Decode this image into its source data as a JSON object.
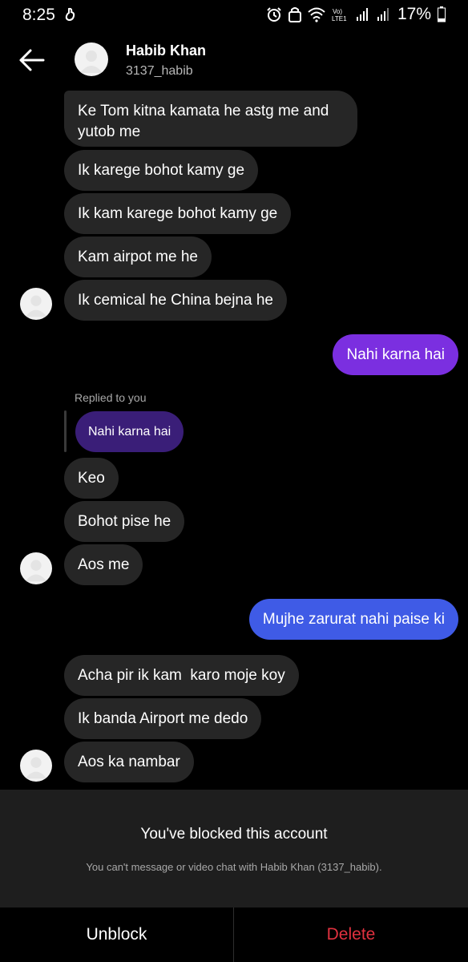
{
  "status_bar": {
    "time": "8:25",
    "battery": "17%",
    "network_label": "Vo) LTE1"
  },
  "header": {
    "name": "Habib Khan",
    "username": "3137_habib"
  },
  "messages": [
    {
      "text": "Ke Tom kitna kamata he astg me and\nyutob me",
      "direction": "in"
    },
    {
      "text": "Ik karege bohot kamy ge",
      "direction": "in"
    },
    {
      "text": "Ik kam karege bohot kamy ge",
      "direction": "in"
    },
    {
      "text": "Kam airpot me he",
      "direction": "in"
    },
    {
      "text": "Ik cemical he China bejna he",
      "direction": "in"
    },
    {
      "text": "Nahi karna hai",
      "direction": "out"
    },
    {
      "text": "Keo",
      "direction": "in"
    },
    {
      "text": "Bohot pise he",
      "direction": "in"
    },
    {
      "text": "Aos me",
      "direction": "in"
    },
    {
      "text": "Mujhe zarurat nahi paise ki",
      "direction": "out"
    },
    {
      "text": "Acha pir ik kam  karo moje koy",
      "direction": "in"
    },
    {
      "text": "Ik banda Airport me dedo",
      "direction": "in"
    },
    {
      "text": "Aos ka nambar",
      "direction": "in"
    }
  ],
  "reply": {
    "label": "Replied to you",
    "quoted_text": "Nahi karna hai"
  },
  "blocked": {
    "title": "You've blocked this account",
    "subtitle": "You can't message or video chat with Habib Khan (3137_habib)."
  },
  "actions": {
    "unblock": "Unblock",
    "delete": "Delete"
  },
  "colors": {
    "incoming_bubble": "#262626",
    "outgoing_purple": "#7b2fe0",
    "outgoing_blue": "#3f5be6",
    "delete_red": "#e0313f"
  }
}
